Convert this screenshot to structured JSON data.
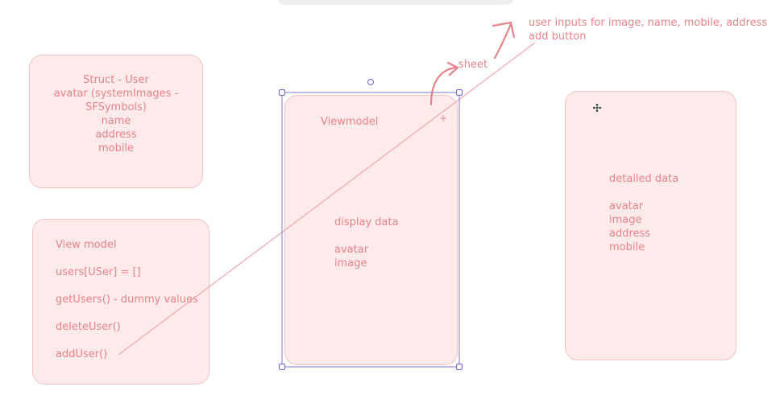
{
  "struct_card": {
    "lines": [
      "Struct - User",
      "avatar (systemImages -",
      "SFSymbols)",
      "name",
      "address",
      "mobile"
    ]
  },
  "viewmodel_card": {
    "lines": [
      "View model",
      "users[USer] = []",
      "getUsers() - dummy values",
      "deleteUser()",
      "addUser()"
    ]
  },
  "phone_screen": {
    "title": "Viewmodel",
    "plus": "+",
    "display_label": "display data",
    "fields": [
      "avatar",
      "image"
    ]
  },
  "sheet_annotation": {
    "label": "sheet",
    "note_lines": [
      "user inputs for image, name, mobile, address",
      "add button"
    ]
  },
  "detail_card": {
    "title": "detailed data",
    "fields": [
      "avatar",
      "image",
      "address",
      "mobile"
    ]
  },
  "colors": {
    "card_fill": "#fdeaea",
    "card_border": "#f3c4c4",
    "text": "#e8838c",
    "selection": "#7b75d9"
  }
}
